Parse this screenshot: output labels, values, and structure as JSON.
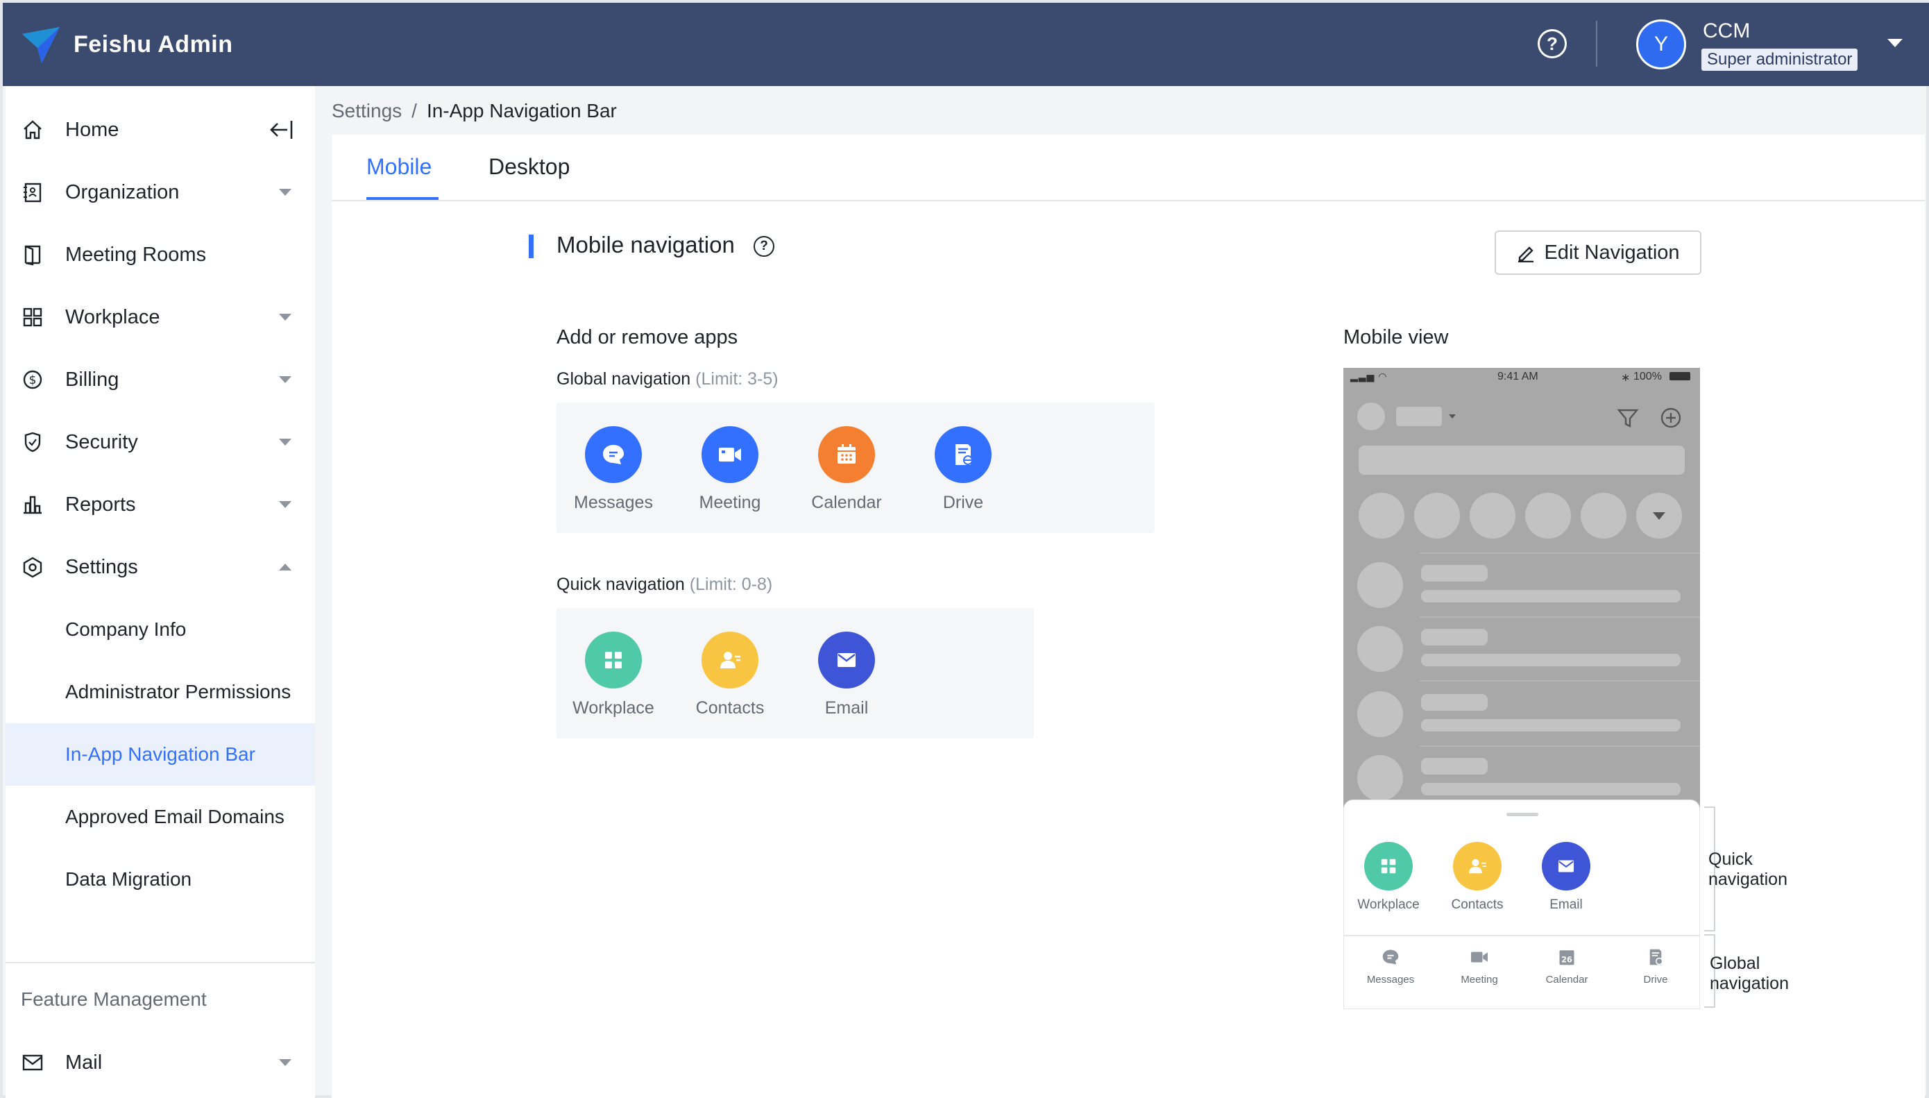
{
  "app": {
    "title": "Feishu Admin"
  },
  "header": {
    "help_icon": "question-circle-icon",
    "user": {
      "initial": "Y",
      "name": "CCM",
      "role": "Super administrator"
    }
  },
  "sidebar": {
    "items": [
      {
        "label": "Home",
        "icon": "home-icon"
      },
      {
        "label": "Organization",
        "icon": "contacts-book-icon"
      },
      {
        "label": "Meeting Rooms",
        "icon": "door-icon"
      },
      {
        "label": "Workplace",
        "icon": "grid-icon"
      },
      {
        "label": "Billing",
        "icon": "dollar-circle-icon"
      },
      {
        "label": "Security",
        "icon": "shield-icon"
      },
      {
        "label": "Reports",
        "icon": "bar-chart-icon"
      },
      {
        "label": "Settings",
        "icon": "hexagon-gear-icon"
      }
    ],
    "settings_sub": [
      {
        "label": "Company Info"
      },
      {
        "label": "Administrator Permissions"
      },
      {
        "label": "In-App Navigation Bar"
      },
      {
        "label": "Approved Email Domains"
      },
      {
        "label": "Data Migration"
      }
    ],
    "section_label": "Feature Management",
    "mail": {
      "label": "Mail",
      "icon": "mail-icon"
    }
  },
  "breadcrumb": {
    "parent": "Settings",
    "separator": "/",
    "current": "In-App Navigation Bar"
  },
  "tabs": [
    {
      "label": "Mobile"
    },
    {
      "label": "Desktop"
    }
  ],
  "section": {
    "title": "Mobile navigation",
    "edit_label": "Edit Navigation"
  },
  "add_remove": {
    "title": "Add or remove apps",
    "global": {
      "label": "Global navigation",
      "limit": "(Limit: 3-5)",
      "apps": [
        {
          "label": "Messages",
          "color": "#3370ff",
          "icon": "chat-bubble-icon"
        },
        {
          "label": "Meeting",
          "color": "#3370ff",
          "icon": "video-camera-icon"
        },
        {
          "label": "Calendar",
          "color": "#f57f30",
          "icon": "calendar-icon"
        },
        {
          "label": "Drive",
          "color": "#3370ff",
          "icon": "drive-doc-icon"
        }
      ]
    },
    "quick": {
      "label": "Quick navigation",
      "limit": "(Limit: 0-8)",
      "apps": [
        {
          "label": "Workplace",
          "color": "#4fc9a8",
          "icon": "grid-icon"
        },
        {
          "label": "Contacts",
          "color": "#f7c541",
          "icon": "contact-icon"
        },
        {
          "label": "Email",
          "color": "#3d55d6",
          "icon": "envelope-icon"
        }
      ]
    }
  },
  "mobile_view": {
    "title": "Mobile view",
    "status": {
      "time": "9:41 AM",
      "battery": "100%"
    },
    "quick_apps": [
      "Workplace",
      "Contacts",
      "Email"
    ],
    "global_apps": [
      "Messages",
      "Meeting",
      "Calendar",
      "Drive"
    ],
    "calendar_day": "26",
    "annotations": {
      "quick": "Quick navigation",
      "global": "Global navigation"
    }
  }
}
